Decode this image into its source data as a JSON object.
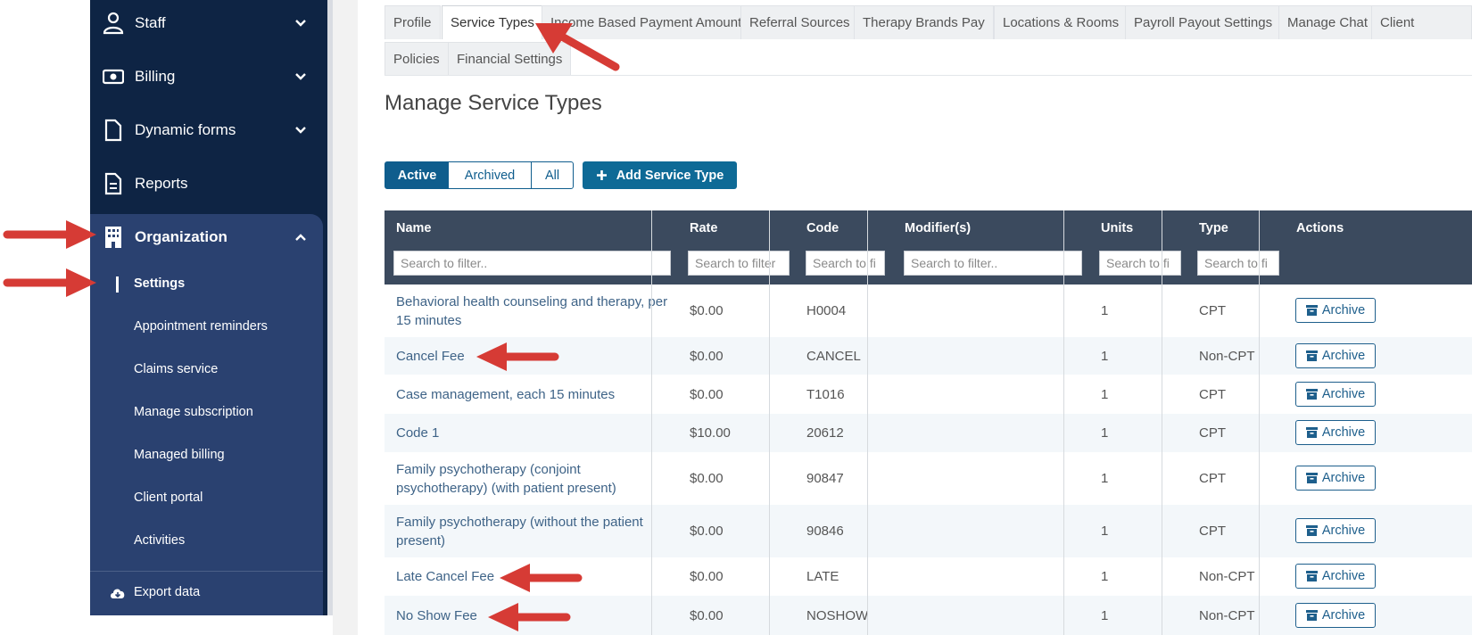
{
  "sidebar": {
    "items": [
      {
        "label": "Staff",
        "icon": "user-icon"
      },
      {
        "label": "Billing",
        "icon": "money-icon"
      },
      {
        "label": "Dynamic forms",
        "icon": "document-icon"
      },
      {
        "label": "Reports",
        "icon": "report-icon"
      },
      {
        "label": "Organization",
        "icon": "building-icon"
      }
    ],
    "organization_sub": [
      "Settings",
      "Appointment reminders",
      "Claims service",
      "Manage subscription",
      "Managed billing",
      "Client portal",
      "Activities"
    ],
    "export_label": "Export data"
  },
  "tabs": [
    "Profile",
    "Service Types",
    "Income Based Payment Amounts",
    "Referral Sources",
    "Therapy Brands Pay",
    "Locations & Rooms",
    "Payroll Payout Settings",
    "Manage Chat",
    "Client",
    "Policies",
    "Financial Settings"
  ],
  "title": "Manage Service Types",
  "filters": {
    "active": "Active",
    "archived": "Archived",
    "all": "All"
  },
  "add_button": "Add Service Type",
  "table": {
    "headers": [
      "Name",
      "Rate",
      "Code",
      "Modifier(s)",
      "Units",
      "Type",
      "Actions"
    ],
    "placeholders": [
      "Search to filter..",
      "Search to filter",
      "Search to fi",
      "Search to filter..",
      "Search to fi",
      "Search to fi"
    ],
    "rows": [
      {
        "name": "Behavioral health counseling and therapy, per 15 minutes",
        "rate": "$0.00",
        "code": "H0004",
        "modifiers": "",
        "units": "1",
        "type": "CPT",
        "action": "Archive"
      },
      {
        "name": "Cancel Fee",
        "rate": "$0.00",
        "code": "CANCEL",
        "modifiers": "",
        "units": "1",
        "type": "Non-CPT",
        "action": "Archive"
      },
      {
        "name": "Case management, each 15 minutes",
        "rate": "$0.00",
        "code": "T1016",
        "modifiers": "",
        "units": "1",
        "type": "CPT",
        "action": "Archive"
      },
      {
        "name": "Code 1",
        "rate": "$10.00",
        "code": "20612",
        "modifiers": "",
        "units": "1",
        "type": "CPT",
        "action": "Archive"
      },
      {
        "name": "Family psychotherapy (conjoint psychotherapy) (with patient present)",
        "rate": "$0.00",
        "code": "90847",
        "modifiers": "",
        "units": "1",
        "type": "CPT",
        "action": "Archive"
      },
      {
        "name": "Family psychotherapy (without the patient present)",
        "rate": "$0.00",
        "code": "90846",
        "modifiers": "",
        "units": "1",
        "type": "CPT",
        "action": "Archive"
      },
      {
        "name": "Late Cancel Fee",
        "rate": "$0.00",
        "code": "LATE",
        "modifiers": "",
        "units": "1",
        "type": "Non-CPT",
        "action": "Archive"
      },
      {
        "name": "No Show Fee",
        "rate": "$0.00",
        "code": "NOSHOW",
        "modifiers": "",
        "units": "1",
        "type": "Non-CPT",
        "action": "Archive"
      }
    ]
  },
  "colors": {
    "sidebar": "#0e2444",
    "org_panel": "#2a4170",
    "accent": "#0f5d8d",
    "arrow": "#d63b35",
    "table_header": "#3b4a5e"
  }
}
